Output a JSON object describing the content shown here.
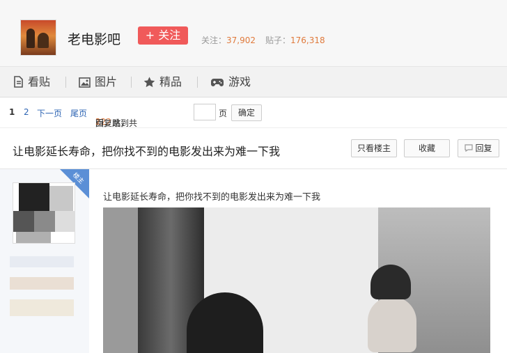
{
  "forum": {
    "name": "老电影吧",
    "follow_label": "+ 关注"
  },
  "stats": {
    "follow_label": "关注：",
    "follow_count": "37,902",
    "posts_label": "贴子：",
    "posts_count": "176,318"
  },
  "nav": {
    "items": [
      {
        "label": "看贴",
        "icon": "document-icon"
      },
      {
        "label": "图片",
        "icon": "image-icon"
      },
      {
        "label": "精品",
        "icon": "star-icon"
      },
      {
        "label": "游戏",
        "icon": "gamepad-icon"
      }
    ]
  },
  "pager": {
    "page1": "1",
    "page2": "2",
    "next": "下一页",
    "last": "尾页",
    "reply_count": "122",
    "reply_suffix": "回复贴，共",
    "total_pages": "2",
    "pages_suffix": "页，跳到",
    "page_unit": "页",
    "confirm": "确定"
  },
  "post": {
    "title": "让电影延长寿命，把你找不到的电影发出来为难一下我",
    "only_op": "只看楼主",
    "favorite": "收藏",
    "reply": "回复",
    "lz_badge": "楼主",
    "content_text": "让电影延长寿命，把你找不到的电影发出来为难一下我"
  },
  "colors": {
    "follow_button": "#f05a5a",
    "link": "#2d64b3",
    "highlight": "#e07a3c",
    "lz_badge": "#5b8fd6"
  }
}
